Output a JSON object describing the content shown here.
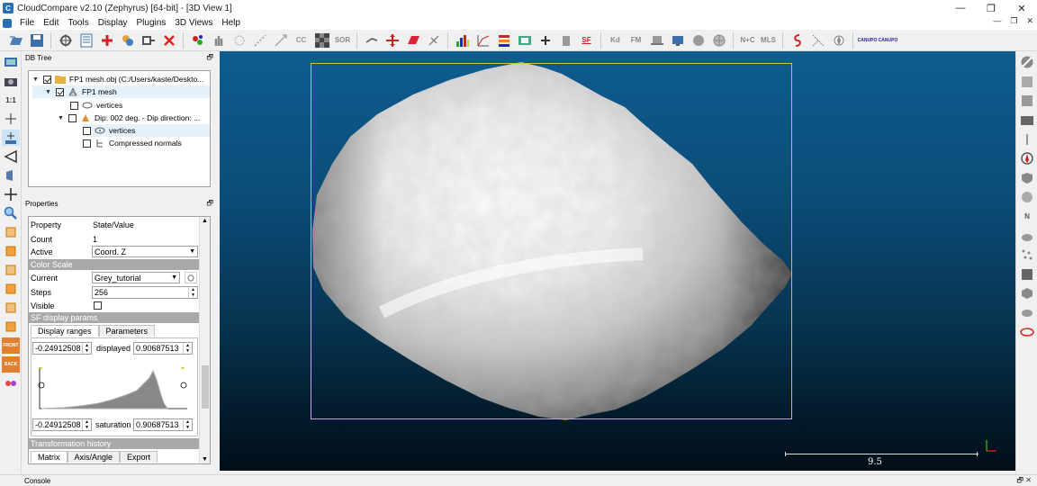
{
  "window": {
    "title": "CloudCompare v2.10 (Zephyrus) [64-bit] - [3D View 1]",
    "app_icon": "C",
    "controls": [
      "—",
      "❐",
      "✕"
    ]
  },
  "menubar": {
    "items": [
      "File",
      "Edit",
      "Tools",
      "Display",
      "Plugins",
      "3D Views",
      "Help"
    ],
    "mdi_controls": [
      "—",
      "❐",
      "✕"
    ]
  },
  "toolbar": {
    "sor_label": "SOR",
    "sf_label": "SF",
    "kd_label": "Kd",
    "fm_label": "FM",
    "nc_label": "N+C",
    "mls_label": "MLS",
    "canupo_create": "CANUPO",
    "canupo_classify": "CANUPO"
  },
  "left_toolbar": {
    "ratio_label": "1:1",
    "front_label": "FRONT",
    "back_label": "BACK"
  },
  "right_toolbar": {
    "n_label": "N"
  },
  "dbtree": {
    "title": "DB Tree",
    "float_icon": "🗗",
    "rows": [
      {
        "label": "FP1 mesh.obj (C:/Users/kaste/Deskto..."
      },
      {
        "label": "FP1 mesh"
      },
      {
        "label": "vertices"
      },
      {
        "label": "Dip: 002 deg. - Dip direction: ..."
      },
      {
        "label": "vertices"
      },
      {
        "label": "Compressed normals"
      }
    ]
  },
  "properties": {
    "title": "Properties",
    "float_icon": "🗗",
    "header": {
      "property": "Property",
      "value": "State/Value"
    },
    "count": {
      "key": "Count",
      "value": "1"
    },
    "active": {
      "key": "Active",
      "value": "Coord. Z"
    },
    "color_scale_section": "Color Scale",
    "current": {
      "key": "Current",
      "value": "Grey_tutorial"
    },
    "steps": {
      "key": "Steps",
      "value": "256"
    },
    "visible": {
      "key": "Visible"
    },
    "sf_section": "SF display params",
    "tabs": [
      "Display ranges",
      "Parameters"
    ],
    "displayed_min": "-0.24912508",
    "displayed_label": "displayed",
    "displayed_max": "0.90687513",
    "saturation_min": "-0.24912508",
    "saturation_label": "saturation",
    "saturation_max": "0.90687513",
    "transform_section": "Transformation history",
    "transform_tabs": [
      "Matrix",
      "Axis/Angle",
      "Export"
    ]
  },
  "view3d": {
    "scale_value": "9.5",
    "background_top": "#0e5c90",
    "background_bottom": "#010e18",
    "bbox_color": "#c8c832"
  },
  "console": {
    "title": "Console",
    "controls": "🗗 ✕"
  }
}
